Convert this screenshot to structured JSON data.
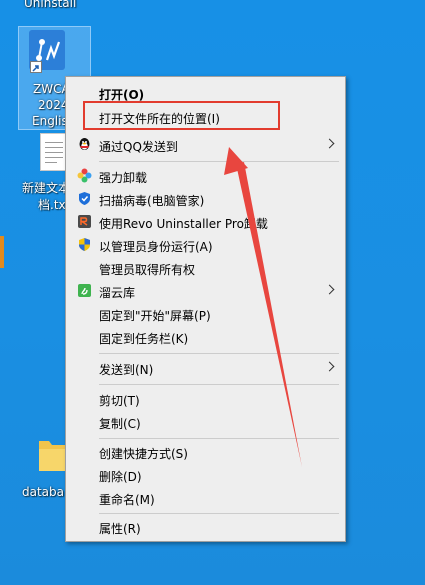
{
  "desktop": {
    "top_label": "Uninstall",
    "app_icon": {
      "line1": "ZWCA",
      "line2": "2024",
      "line3": "Englis"
    },
    "doc_icon": {
      "line1": "新建文本",
      "line2": "档.tx"
    },
    "folder_icon": {
      "label": "databa"
    }
  },
  "context_menu": {
    "items": [
      {
        "label": "打开(O)"
      },
      {
        "label": "打开文件所在的位置(I)"
      },
      {
        "label": "通过QQ发送到"
      },
      {
        "label": "强力卸载"
      },
      {
        "label": "扫描病毒(电脑管家)"
      },
      {
        "label": "使用Revo Uninstaller Pro卸载"
      },
      {
        "label": "以管理员身份运行(A)"
      },
      {
        "label": "管理员取得所有权"
      },
      {
        "label": "溜云库"
      },
      {
        "label": "固定到\"开始\"屏幕(P)"
      },
      {
        "label": "固定到任务栏(K)"
      },
      {
        "label": "发送到(N)"
      },
      {
        "label": "剪切(T)"
      },
      {
        "label": "复制(C)"
      },
      {
        "label": "创建快捷方式(S)"
      },
      {
        "label": "删除(D)"
      },
      {
        "label": "重命名(M)"
      },
      {
        "label": "属性(R)"
      }
    ]
  },
  "colors": {
    "desktop_bg": "#1a8ee0",
    "menu_bg": "#eeeeee",
    "annotation_red": "#e23b2e"
  },
  "icons": {
    "qq": "qq-penguin-icon",
    "uninstall": "colorful-petal-icon",
    "security": "shield-icon",
    "revo": "revo-uninstaller-icon",
    "admin": "uac-shield-icon",
    "cloud": "cloud-library-icon"
  }
}
